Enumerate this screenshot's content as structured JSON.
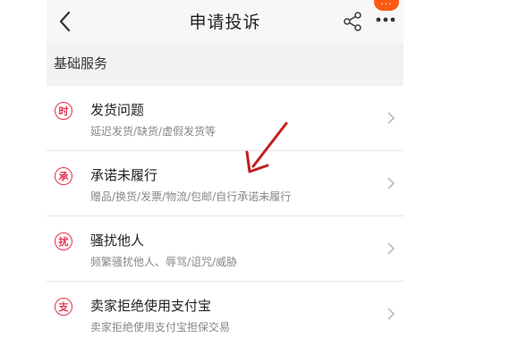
{
  "navbar": {
    "title": "申请投诉",
    "back_icon": "chevron-left-icon",
    "share_icon": "share-icon",
    "more_icon": "more-dots-icon",
    "more_badge": "···"
  },
  "section": {
    "title": "基础服务"
  },
  "items": [
    {
      "icon_char": "时",
      "title": "发货问题",
      "desc": "延迟发货/缺货/虚假发货等"
    },
    {
      "icon_char": "承",
      "title": "承诺未履行",
      "desc": "赠品/换货/发票/物流/包邮/自行承诺未履行"
    },
    {
      "icon_char": "扰",
      "title": "骚扰他人",
      "desc": "频繁骚扰他人、辱骂/诅咒/威胁"
    },
    {
      "icon_char": "支",
      "title": "卖家拒绝使用支付宝",
      "desc": "卖家拒绝使用支付宝担保交易"
    }
  ],
  "colors": {
    "accent_red": "#e4334a",
    "badge_orange": "#ff5a14",
    "annotation_arrow": "#c0201c"
  }
}
